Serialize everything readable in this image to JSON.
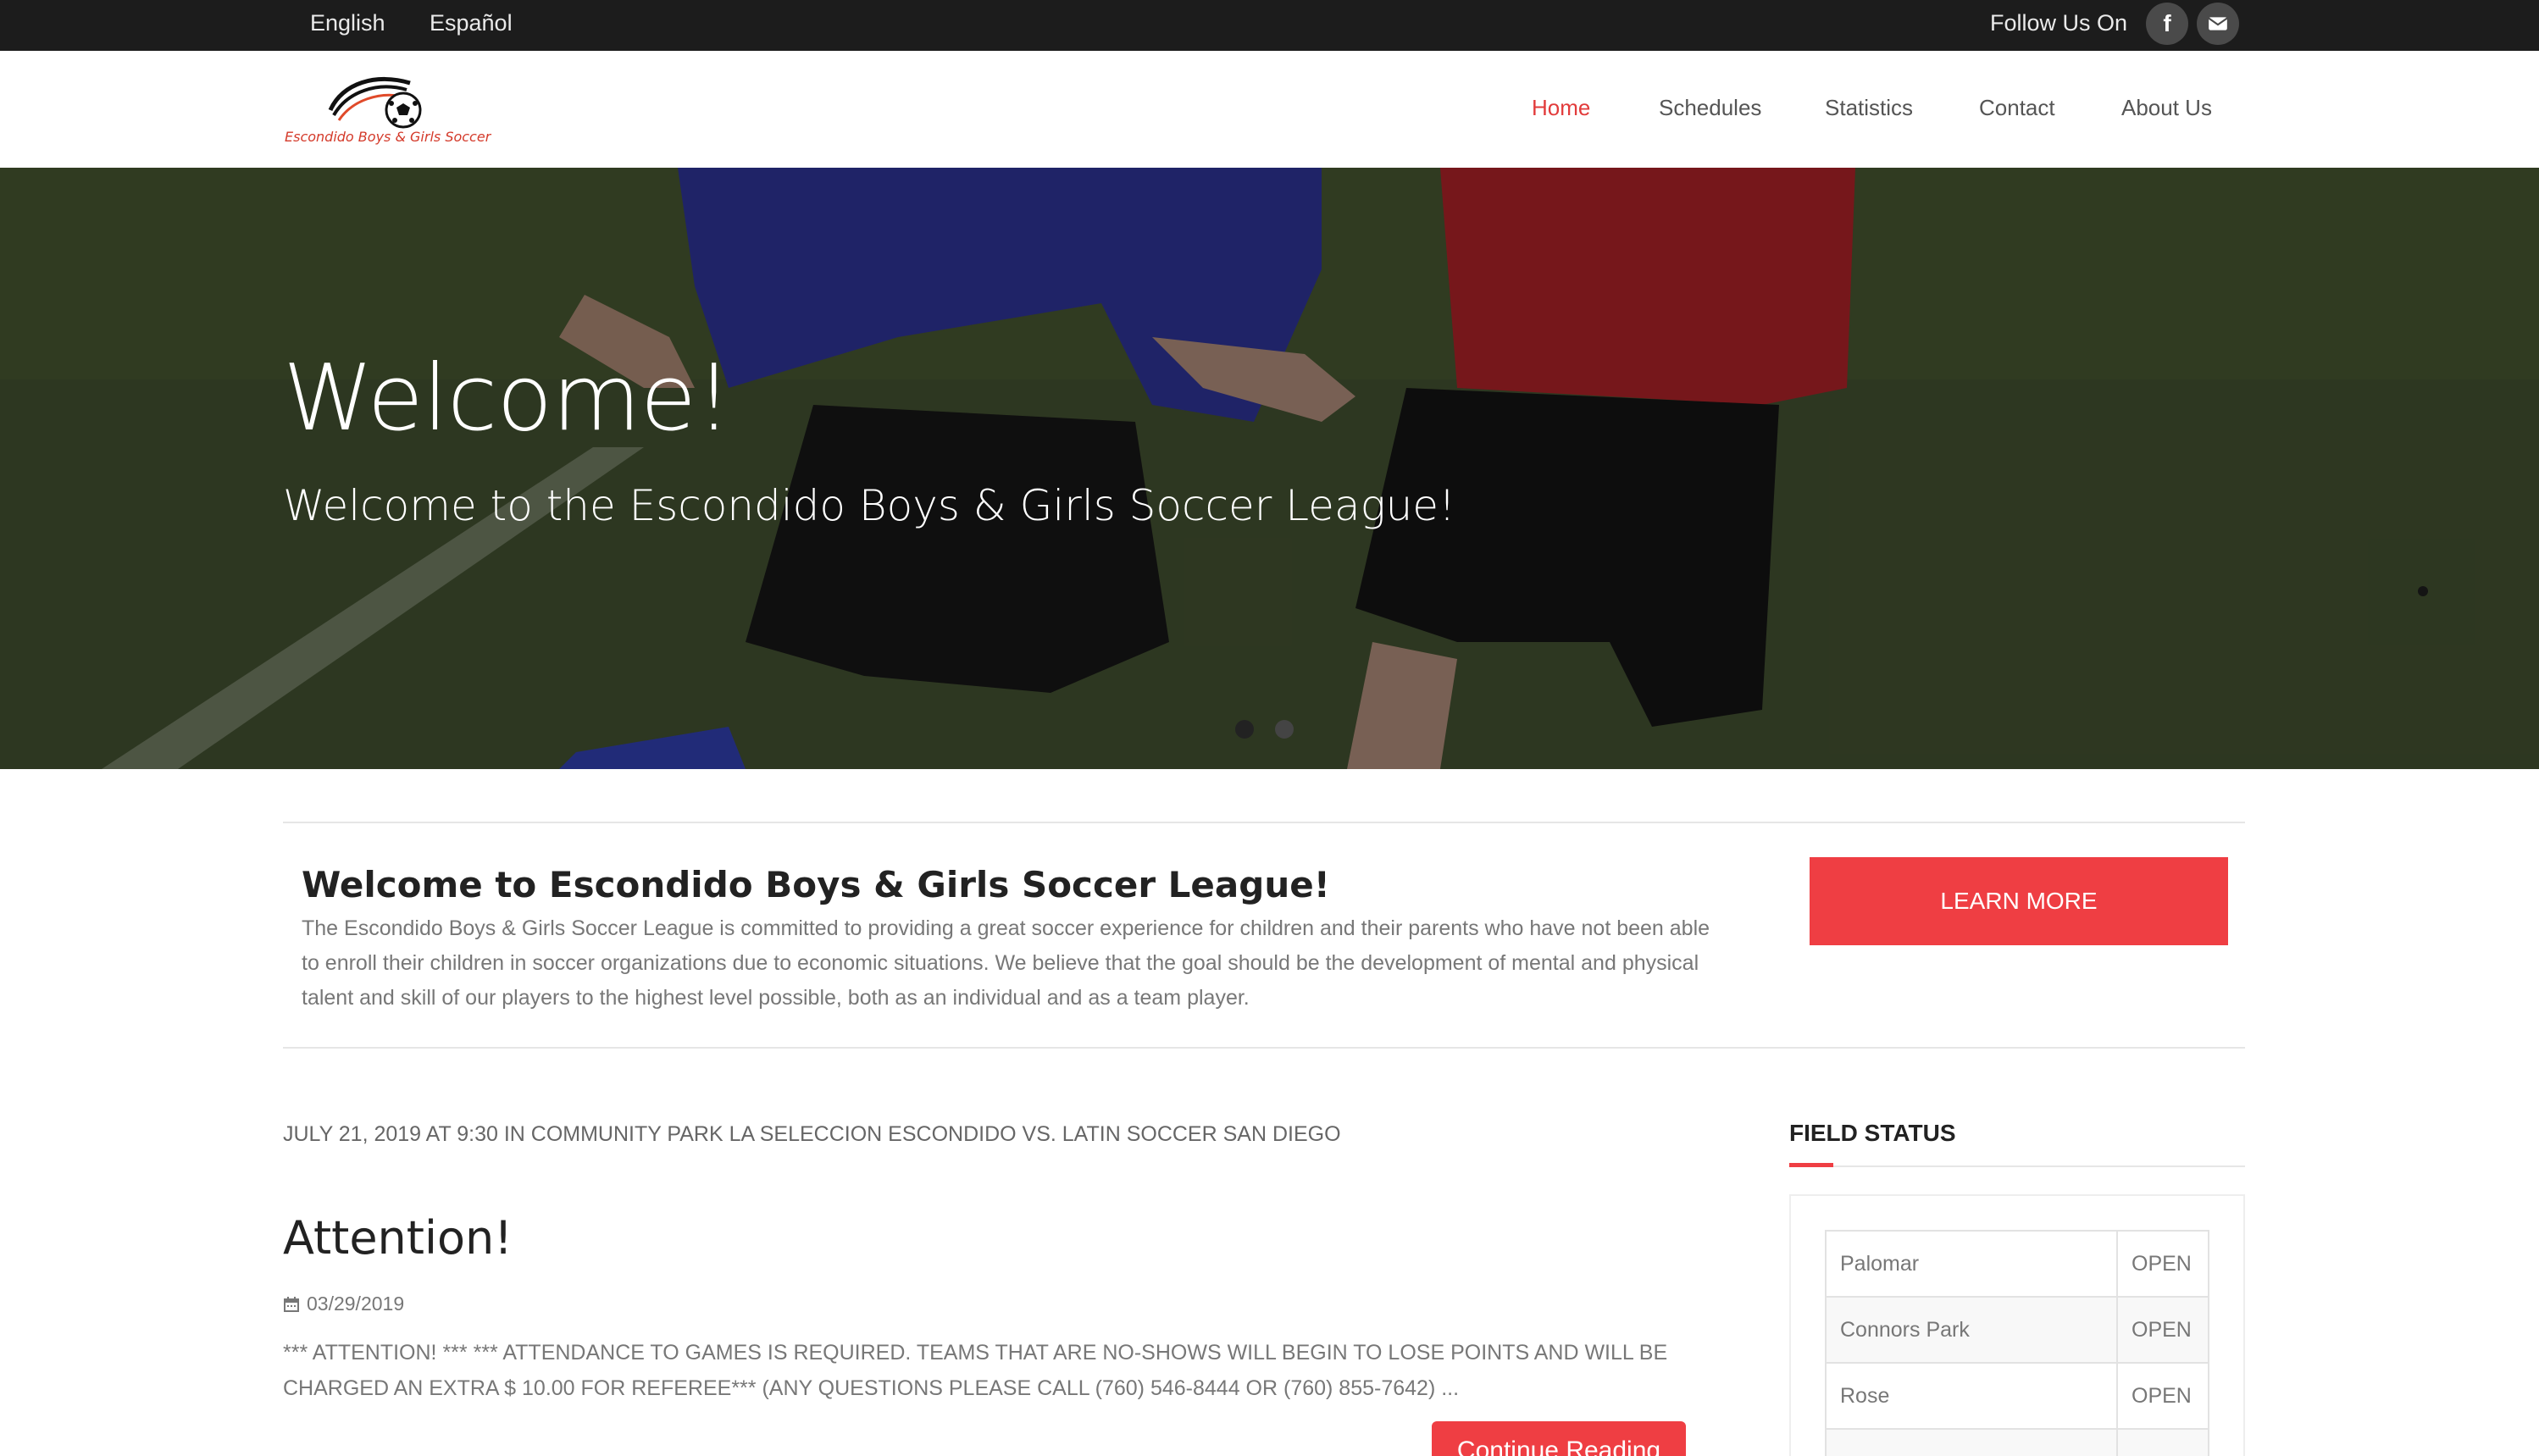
{
  "topbar": {
    "languages": [
      "English",
      "Español"
    ],
    "follow_label": "Follow Us On",
    "social": [
      {
        "name": "facebook-icon",
        "glyph": "f"
      },
      {
        "name": "mail-icon"
      }
    ]
  },
  "header": {
    "logo_text": "Escondido Boys & Girls Soccer",
    "nav": [
      {
        "label": "Home",
        "active": true
      },
      {
        "label": "Schedules",
        "active": false
      },
      {
        "label": "Statistics",
        "active": false
      },
      {
        "label": "Contact",
        "active": false
      },
      {
        "label": "About Us",
        "active": false
      }
    ]
  },
  "hero": {
    "title": "Welcome!",
    "subtitle": "Welcome to the Escondido Boys & Girls Soccer League!",
    "slides": 2,
    "active_slide": 1
  },
  "intro": {
    "title": "Welcome to Escondido Boys & Girls Soccer League!",
    "body": "The Escondido Boys & Girls Soccer League is committed to providing a great soccer experience for children and their parents who have not been able to enroll their children in soccer organizations due to economic situations. We believe that the goal should be the development of mental and physical talent and skill of our players to the highest level possible, both as an individual and as a team player.",
    "button": "LEARN MORE"
  },
  "main": {
    "event_line": "JULY 21, 2019 AT 9:30 IN COMMUNITY PARK LA SELECCION ESCONDIDO VS. LATIN SOCCER SAN DIEGO",
    "post": {
      "title": "Attention!",
      "date": "03/29/2019",
      "excerpt": "*** ATTENTION! *** *** ATTENDANCE TO GAMES IS REQUIRED. TEAMS THAT ARE NO-SHOWS WILL BEGIN TO LOSE POINTS AND WILL BE CHARGED AN EXTRA $ 10.00  FOR REFEREE*** (ANY QUESTIONS PLEASE CALL (760) 546-8444 OR (760) 855-7642) ...",
      "button": "Continue Reading"
    }
  },
  "sidebar": {
    "widget_title": "FIELD STATUS",
    "fields": [
      {
        "name": "Palomar",
        "status": "OPEN"
      },
      {
        "name": "Connors Park",
        "status": "OPEN"
      },
      {
        "name": "Rose",
        "status": "OPEN"
      },
      {
        "name": "",
        "status": ""
      }
    ]
  },
  "colors": {
    "accent": "#ef3e43",
    "topbar": "#1c1c1c",
    "nav_active": "#e23b3b"
  }
}
